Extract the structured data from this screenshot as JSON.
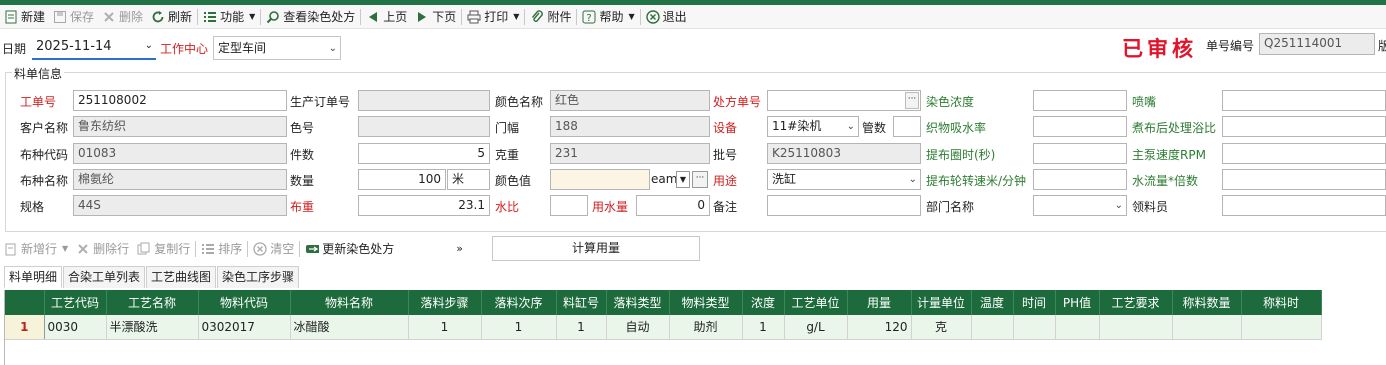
{
  "colors": {
    "accent": "#217346",
    "grid_header": "#1d6b3c",
    "required_label": "#d21f1f",
    "green_label": "#2e7d32",
    "stamp": "#e0142b"
  },
  "toolbar": {
    "new": "新建",
    "save": "保存",
    "delete": "删除",
    "refresh": "刷新",
    "functions": "功能",
    "view_recipe": "查看染色处方",
    "prev": "上页",
    "next": "下页",
    "print": "打印",
    "attachment": "附件",
    "help": "帮助",
    "exit": "退出"
  },
  "header": {
    "date_label": "日期",
    "date_value": "2025-11-14",
    "work_center_label": "工作中心",
    "work_center_value": "定型车间",
    "stamp": "已审核",
    "doc_no_label": "单号编号",
    "doc_no_value": "Q251114001",
    "version_label": "版"
  },
  "form": {
    "group_title": "料单信息",
    "work_order_label": "工单号",
    "work_order_value": "251108002",
    "prod_order_label": "生产订单号",
    "prod_order_value": "",
    "color_name_label": "颜色名称",
    "color_name_value": "红色",
    "recipe_no_label": "处方单号",
    "recipe_no_value": "",
    "dye_conc_label": "染色浓度",
    "dye_conc_value": "",
    "nozzle_label": "喷嘴",
    "nozzle_value": "",
    "customer_label": "客户名称",
    "customer_value": "鲁东纺织",
    "color_no_label": "色号",
    "color_no_value": "",
    "width_label": "门幅",
    "width_value": "188",
    "equipment_label": "设备",
    "equipment_value": "11#染机",
    "pipes_label": "管数",
    "pipes_value": "",
    "absorb_label": "织物吸水率",
    "absorb_value": "",
    "after_bath_label": "煮布后处理浴比",
    "after_bath_value": "",
    "fabric_code_label": "布种代码",
    "fabric_code_value": "01083",
    "pieces_label": "件数",
    "pieces_value": "5",
    "gram_label": "克重",
    "gram_value": "231",
    "batch_label": "批号",
    "batch_value": "K25110803",
    "lift_time_label": "提布圈时(秒)",
    "lift_time_value": "",
    "pump_label": "主泵速度RPM",
    "pump_value": "",
    "fabric_name_label": "布种名称",
    "fabric_name_value": "棉氨纶",
    "qty_label": "数量",
    "qty_value": "100",
    "qty_unit": "米",
    "color_val_label": "颜色值",
    "color_val_value": "",
    "color_val_suffix": "eam",
    "usage_label": "用途",
    "usage_value": "洗缸",
    "wheel_speed_label": "提布轮转速米/分钟",
    "wheel_speed_value": "",
    "water_mult_label": "水流量*倍数",
    "water_mult_value": "",
    "spec_label": "规格",
    "spec_value": "44S",
    "fabric_weight_label": "布重",
    "fabric_weight_value": "23.1",
    "water_ratio_label": "水比",
    "water_ratio_value": "",
    "water_qty_label": "用水量",
    "water_qty_value": "0",
    "remark_label": "备注",
    "remark_value": "",
    "dept_label": "部门名称",
    "dept_value": "",
    "picker_label": "领料员",
    "picker_value": ""
  },
  "toolbar2": {
    "add_row": "新增行",
    "delete_row": "删除行",
    "copy_row": "复制行",
    "sort": "排序",
    "clear": "清空",
    "update_recipe": "更新染色处方",
    "calc": "计算用量"
  },
  "tabs": [
    "料单明细",
    "合染工单列表",
    "工艺曲线图",
    "染色工序步骤"
  ],
  "grid": {
    "columns": [
      "工艺代码",
      "工艺名称",
      "物料代码",
      "物料名称",
      "落料步骤",
      "落料次序",
      "料缸号",
      "落料类型",
      "物料类型",
      "浓度",
      "工艺单位",
      "用量",
      "计量单位",
      "温度",
      "时间",
      "PH值",
      "工艺要求",
      "称料数量",
      "称料时"
    ],
    "rows": [
      {
        "no": "1",
        "cells": [
          "0030",
          "半漂酸洗",
          "0302017",
          "冰醋酸",
          "1",
          "1",
          "1",
          "自动",
          "助剂",
          "1",
          "g/L",
          "120",
          "克",
          "",
          "",
          "",
          "",
          "",
          ""
        ]
      }
    ]
  }
}
